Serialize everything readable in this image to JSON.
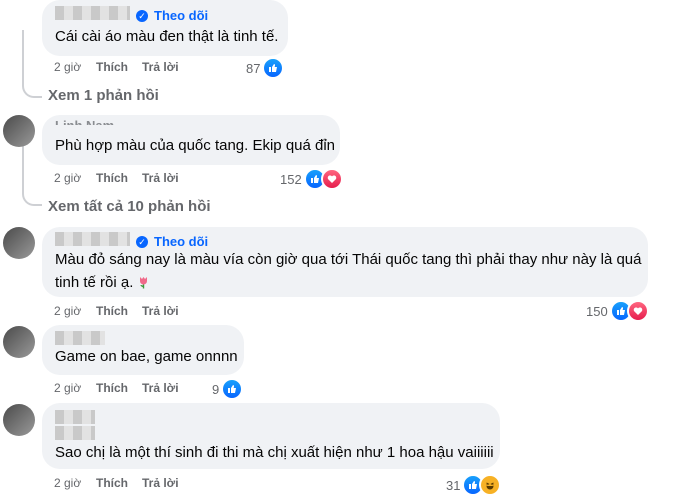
{
  "comments": [
    {
      "follow_label": "Theo dõi",
      "text": "Cái cài áo màu đen thật là tinh tế.",
      "time": "2 giờ",
      "like_label": "Thích",
      "reply_label": "Trả lời",
      "reaction_count": "87",
      "reactions": [
        "like-icon"
      ]
    },
    {
      "name": "Linh Nam",
      "text": "Phù hợp màu của quốc tang. Ekip quá đỉn",
      "time": "2 giờ",
      "like_label": "Thích",
      "reply_label": "Trả lời",
      "reaction_count": "152",
      "reactions": [
        "like-icon",
        "love-icon"
      ]
    },
    {
      "follow_label": "Theo dõi",
      "text_line1": "Màu đỏ sáng nay là màu vía còn giờ qua tới Thái quốc tang thì phải thay như này là quá",
      "text_line2": "tinh tế rồi ạ.",
      "time": "2 giờ",
      "like_label": "Thích",
      "reply_label": "Trả lời",
      "reaction_count": "150",
      "reactions": [
        "like-icon",
        "love-icon"
      ]
    },
    {
      "text": "Game on bae, game onnnn",
      "time": "2 giờ",
      "like_label": "Thích",
      "reply_label": "Trả lời",
      "reaction_count": "9",
      "reactions": [
        "like-icon"
      ]
    },
    {
      "text": "Sao chị là một thí sinh đi thi mà chị xuất hiện như 1 hoa hậu vaiiiiii",
      "time": "2 giờ",
      "like_label": "Thích",
      "reply_label": "Trả lời",
      "reaction_count": "31",
      "reactions": [
        "like-icon",
        "haha-icon"
      ]
    }
  ],
  "reply_links": {
    "first": "Xem 1 phản hồi",
    "second": "Xem tất cả 10 phản hồi"
  },
  "colors": {
    "link": "#0866ff",
    "meta": "#65676b",
    "bubble": "#f0f2f5"
  }
}
